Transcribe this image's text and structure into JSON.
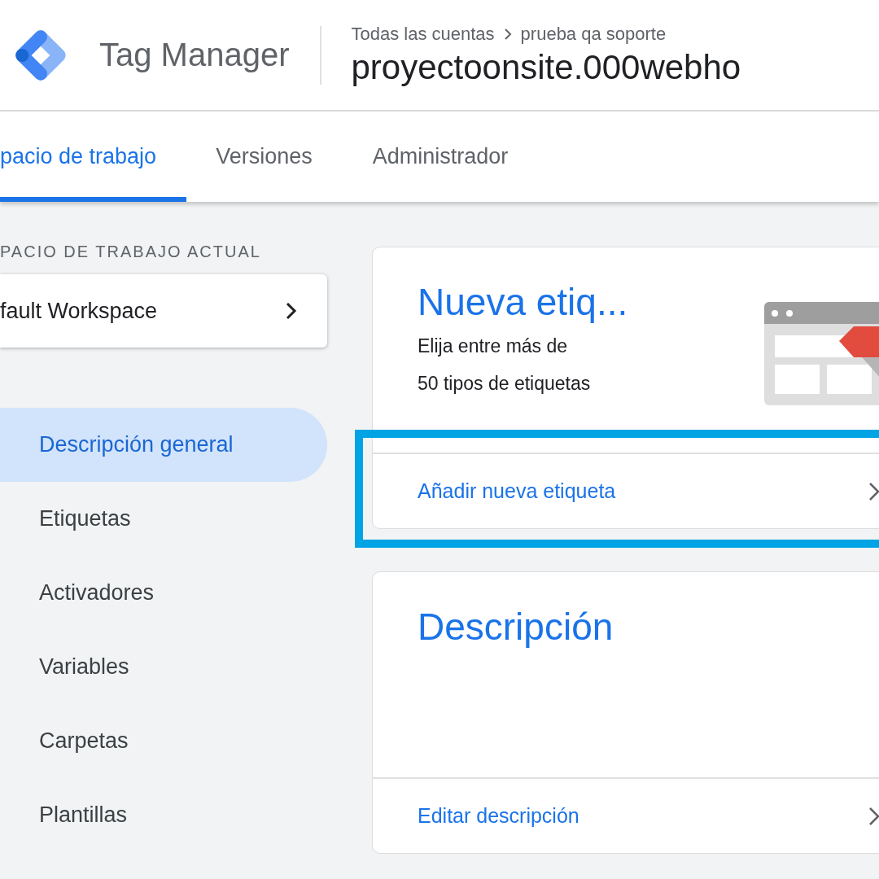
{
  "header": {
    "product": "Tag Manager",
    "breadcrumb": [
      {
        "text": "Todas las cuentas"
      },
      {
        "text": "prueba qa soporte"
      }
    ],
    "container_name": "proyectoonsite.000webho"
  },
  "tabs": [
    {
      "label": "pacio de trabajo",
      "selected": true
    },
    {
      "label": "Versiones",
      "selected": false
    },
    {
      "label": "Administrador",
      "selected": false
    }
  ],
  "sidebar": {
    "section_label": "PACIO DE TRABAJO ACTUAL",
    "workspace": "fault Workspace",
    "items": [
      {
        "label": "Descripción general",
        "selected": true
      },
      {
        "label": "Etiquetas",
        "selected": false
      },
      {
        "label": "Activadores",
        "selected": false
      },
      {
        "label": "Variables",
        "selected": false
      },
      {
        "label": "Carpetas",
        "selected": false
      },
      {
        "label": "Plantillas",
        "selected": false
      }
    ]
  },
  "cards": [
    {
      "title": "Nueva etiq...",
      "description": "Elija entre más de 50 tipos de etiquetas",
      "illustration": true,
      "link": "Añadir nueva etiqueta",
      "highlighted": true
    },
    {
      "title": "Descripción",
      "link": "Editar descripción",
      "highlighted": false
    }
  ]
}
